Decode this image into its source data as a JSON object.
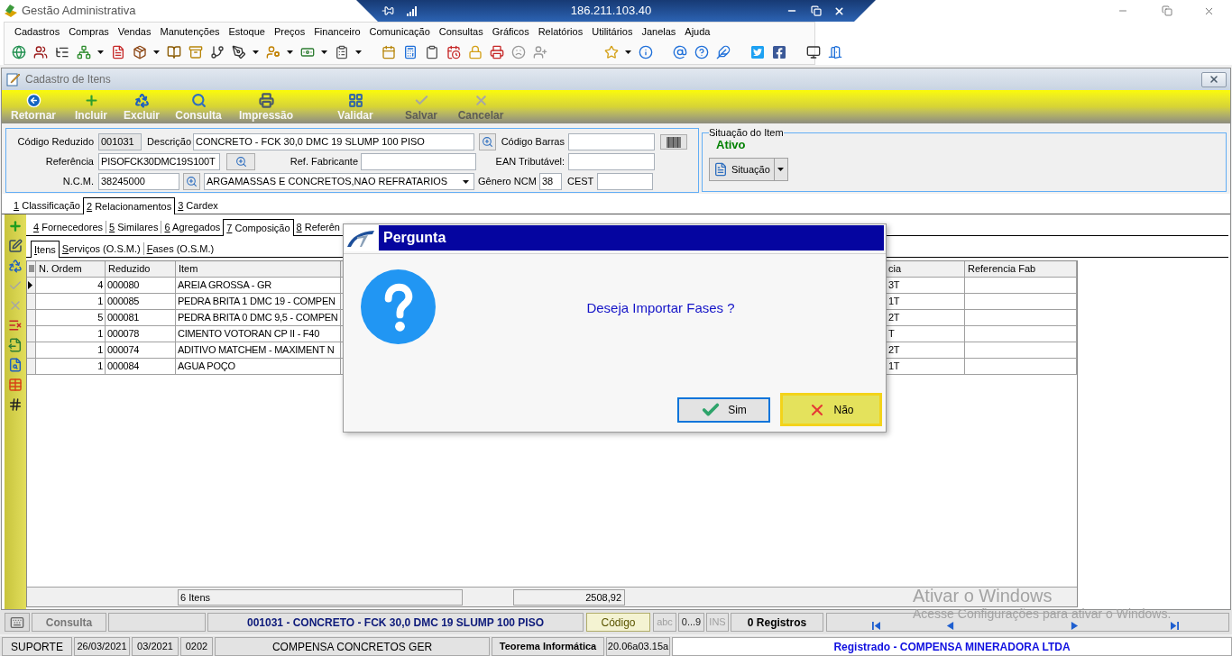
{
  "app": {
    "title": "Gestão Administrativa"
  },
  "remote_session": {
    "address": "186.211.103.40"
  },
  "menu": [
    "Cadastros",
    "Compras",
    "Vendas",
    "Manutenções",
    "Estoque",
    "Preços",
    "Financeiro",
    "Comunicação",
    "Consultas",
    "Gráficos",
    "Relatórios",
    "Utilitários",
    "Janelas",
    "Ajuda"
  ],
  "window": {
    "title": "Cadastro de Itens"
  },
  "actions": [
    {
      "label": "Retornar",
      "kind": "back",
      "disabled": false
    },
    {
      "label": "Incluir",
      "kind": "add",
      "disabled": false
    },
    {
      "label": "Excluir",
      "kind": "delete",
      "disabled": false
    },
    {
      "label": "Consulta",
      "kind": "search",
      "disabled": false
    },
    {
      "label": "Impressão",
      "kind": "print",
      "disabled": false
    },
    {
      "label": "Validar",
      "kind": "validate",
      "disabled": false
    },
    {
      "label": "Salvar",
      "kind": "save",
      "disabled": true
    },
    {
      "label": "Cancelar",
      "kind": "cancel",
      "disabled": true
    }
  ],
  "form": {
    "codigo_reduzido": {
      "label": "Código Reduzido",
      "value": "001031"
    },
    "descricao": {
      "label": "Descrição",
      "value": "CONCRETO - FCK 30,0 DMC 19 SLUMP 100 PISO"
    },
    "codigo_barras": {
      "label": "Código Barras"
    },
    "referencia": {
      "label": "Referência",
      "value": "PISOFCK30DMC19S100T"
    },
    "ref_fabricante": {
      "label": "Ref. Fabricante"
    },
    "ean_tributavel": {
      "label": "EAN Tributável:"
    },
    "ncm": {
      "label": "N.C.M.",
      "value": "38245000"
    },
    "ncm_descricao": {
      "value": "ARGAMASSAS E CONCRETOS,NAO REFRATARIOS"
    },
    "genero_ncm": {
      "label": "Gênero NCM",
      "value": "38"
    },
    "cest": {
      "label": "CEST"
    }
  },
  "item_status": {
    "title": "Situação do Item",
    "status": "Ativo",
    "button": "Situação"
  },
  "tabs": [
    {
      "label": "1 Classificação",
      "selected": false
    },
    {
      "label": "2 Relacionamentos",
      "selected": true
    },
    {
      "label": "3 Cardex",
      "selected": false
    }
  ],
  "sub_tabs": [
    {
      "label": "4 Fornecedores",
      "selected": false
    },
    {
      "label": "5 Similares",
      "selected": false
    },
    {
      "label": "6 Agregados",
      "selected": false
    },
    {
      "label": "7 Composição",
      "selected": true
    },
    {
      "label": "8 Referên",
      "selected": false
    }
  ],
  "inner_tabs": [
    {
      "label": "Itens",
      "selected": true
    },
    {
      "label": "Serviços (O.S.M.)",
      "selected": false
    },
    {
      "label": "Fases (O.S.M.)",
      "selected": false
    }
  ],
  "side_tools": [
    {
      "kind": "add",
      "disabled": false
    },
    {
      "kind": "edit",
      "disabled": false
    },
    {
      "kind": "delete",
      "disabled": false
    },
    {
      "kind": "confirm",
      "disabled": true
    },
    {
      "kind": "cancel",
      "disabled": true
    },
    {
      "kind": "remove",
      "disabled": false
    },
    {
      "kind": "export",
      "disabled": false
    },
    {
      "kind": "find",
      "disabled": false
    },
    {
      "kind": "grid",
      "disabled": false
    },
    {
      "kind": "numbers",
      "disabled": false
    }
  ],
  "table": {
    "columns": [
      "N. Ordem",
      "Reduzido",
      "Item",
      "cia",
      "Referencia Fab"
    ],
    "rows": [
      {
        "selected": true,
        "cells": [
          "4",
          "000080",
          "AREIA GROSSA - GR",
          "3T"
        ]
      },
      {
        "selected": false,
        "cells": [
          "1",
          "000085",
          "PEDRA BRITA 1 DMC 19 - COMPEN",
          "1T"
        ]
      },
      {
        "selected": false,
        "cells": [
          "5",
          "000081",
          "PEDRA BRITA 0 DMC 9,5 - COMPEN",
          "2T"
        ]
      },
      {
        "selected": false,
        "cells": [
          "1",
          "000078",
          "CIMENTO VOTORAN CP II - F40",
          "T"
        ]
      },
      {
        "selected": false,
        "cells": [
          "1",
          "000074",
          "ADITIVO MATCHEM - MAXIMENT N",
          "2T"
        ]
      },
      {
        "selected": false,
        "cells": [
          "1",
          "000084",
          "AGUA POÇO",
          "1T"
        ]
      }
    ],
    "footer": {
      "count": "6 Itens",
      "total": "2508,92"
    }
  },
  "dialog": {
    "title": "Pergunta",
    "message": "Deseja Importar Fases ?",
    "buttons": [
      {
        "label": "Sim",
        "kind": "confirm",
        "focused": true,
        "highlighted": false
      },
      {
        "label": "Não",
        "kind": "cancel",
        "focused": false,
        "highlighted": true
      }
    ]
  },
  "status_bar": {
    "mode": "Consulta",
    "record": "001031 - CONCRETO - FCK 30,0 DMC 19 SLUMP 100 PISO",
    "sort_key": "Código",
    "indicators": [
      {
        "label": "abc",
        "on": false
      },
      {
        "label": "0...9",
        "on": true
      },
      {
        "label": "INS",
        "on": false
      }
    ],
    "records": "0 Registros"
  },
  "info_bar": {
    "user": "SUPORTE",
    "date": "26/03/2021",
    "period": "03/2021",
    "branch": "0202",
    "company": "COMPENSA CONCRETOS GER",
    "vendor": "Teorema Informática",
    "version": "20.06a03.15a",
    "license": "Registrado - COMPENSA MINERADORA LTDA"
  },
  "windows_activation": {
    "title": "Ativar o Windows",
    "text": "Acesse Configurações para ativar o Windows."
  }
}
